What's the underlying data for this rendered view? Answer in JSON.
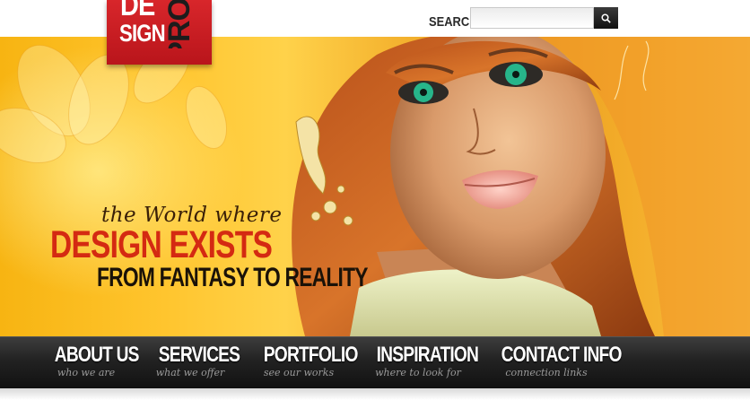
{
  "logo": {
    "line1": "DE",
    "line2": "SIGN",
    "side": "PRO"
  },
  "search": {
    "label": "SEARCH",
    "placeholder": "",
    "value": "",
    "button_icon": "magnifier-icon"
  },
  "hero": {
    "tagline_script": "the World where",
    "headline": "DESIGN EXISTS",
    "subheadline": "FROM FANTASY TO REALITY"
  },
  "nav": {
    "items": [
      {
        "label": "ABOUT US",
        "sub": "who we are"
      },
      {
        "label": "SERVICES",
        "sub": "what we offer"
      },
      {
        "label": "PORTFOLIO",
        "sub": "see our works"
      },
      {
        "label": "INSPIRATION",
        "sub": "where to look for"
      },
      {
        "label": "CONTACT INFO",
        "sub": "connection links"
      }
    ]
  },
  "colors": {
    "brand_red": "#c41c22",
    "headline_red": "#d42a12",
    "nav_bg": "#1f1f1f",
    "hero_orange": "#f5b531"
  }
}
